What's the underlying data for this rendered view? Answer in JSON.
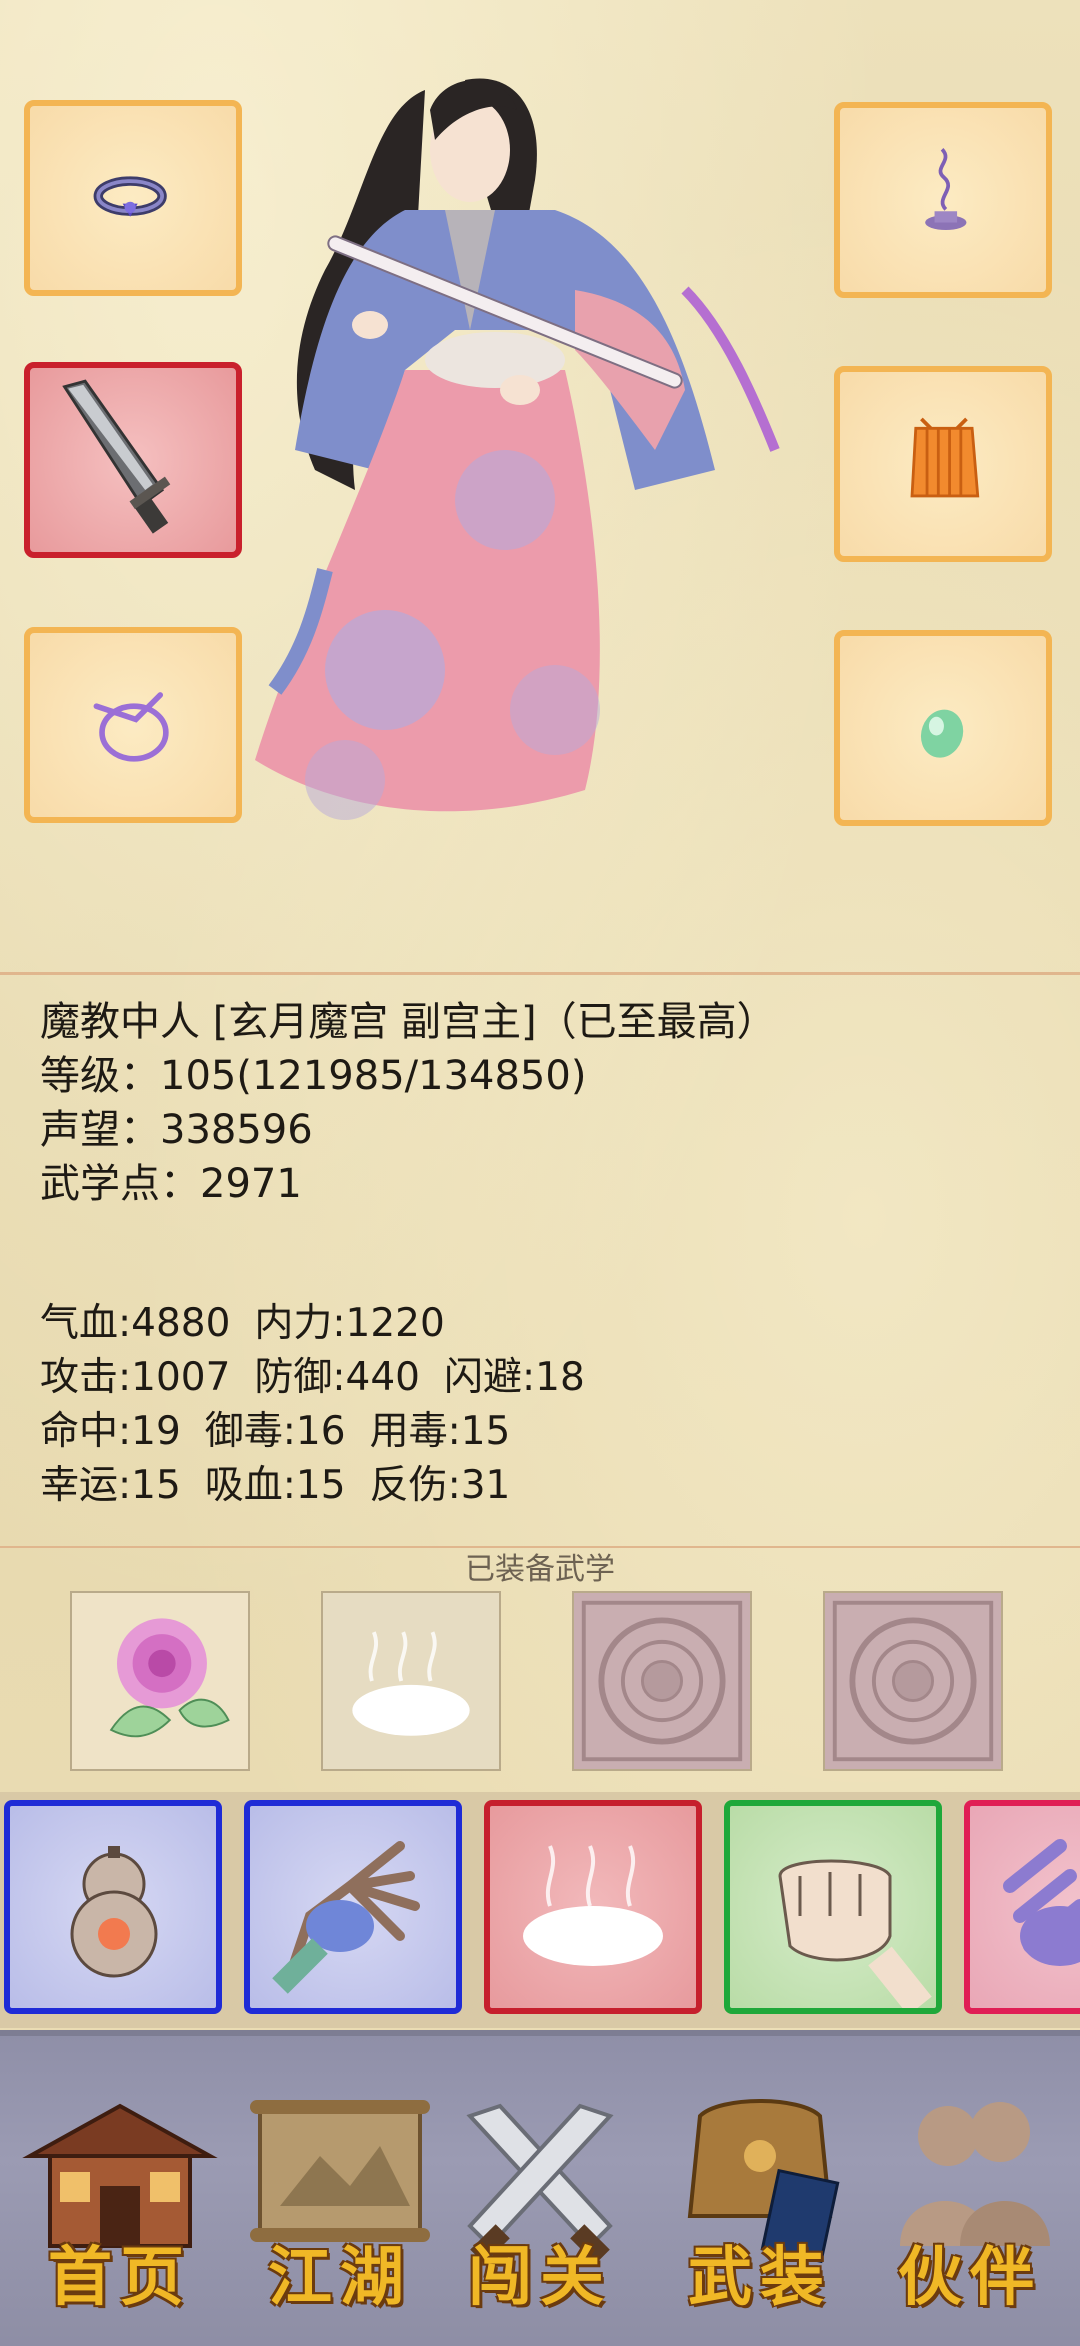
{
  "character": {
    "title_line": "魔教中人 [玄月魔宫 副宫主]（已至最高）",
    "level_label": "等级：",
    "level_value": "105(121985/134850)",
    "reputation_label": "声望：",
    "reputation_value": "338596",
    "martial_points_label": "武学点：",
    "martial_points_value": "2971"
  },
  "stats": {
    "hp": {
      "label": "气血:",
      "value": "4880"
    },
    "internal_power": {
      "label": "内力:",
      "value": "1220"
    },
    "attack": {
      "label": "攻击:",
      "value": "1007"
    },
    "defense": {
      "label": "防御:",
      "value": "440"
    },
    "dodge": {
      "label": "闪避:",
      "value": "18"
    },
    "hit": {
      "label": "命中:",
      "value": "19"
    },
    "poison_resist": {
      "label": "御毒:",
      "value": "16"
    },
    "use_poison": {
      "label": "用毒:",
      "value": "15"
    },
    "luck": {
      "label": "幸运:",
      "value": "15"
    },
    "lifesteal": {
      "label": "吸血:",
      "value": "15"
    },
    "reflect": {
      "label": "反伤:",
      "value": "31"
    }
  },
  "equipped_section_label": "已装备武学",
  "equipment_slots": {
    "left": [
      "ring-icon",
      "sword-icon",
      "bracelet-icon"
    ],
    "right": [
      "incense-icon",
      "armor-icon",
      "jade-icon"
    ]
  },
  "equipped_skills": [
    "rose-skill-icon",
    "mist-skill-icon",
    "empty-slot-icon",
    "empty-slot-icon"
  ],
  "skill_cards": [
    {
      "icon": "gourd-skill-icon",
      "border": "#1f2bd6"
    },
    {
      "icon": "palm-skill-icon",
      "border": "#1f2bd6"
    },
    {
      "icon": "mist-skill-icon",
      "border": "#c61f2d"
    },
    {
      "icon": "fist-skill-icon",
      "border": "#1fa83a"
    },
    {
      "icon": "hand-skill-icon",
      "border": "#e01e55"
    }
  ],
  "nav": {
    "home": "首页",
    "jianghu": "江湖",
    "challenge": "闯关",
    "gear": "武装",
    "partner": "伙伴"
  },
  "colors": {
    "slot_border": "#f3b553",
    "nav_text": "#f0b826",
    "nav_bar": "#9b9bb3"
  }
}
